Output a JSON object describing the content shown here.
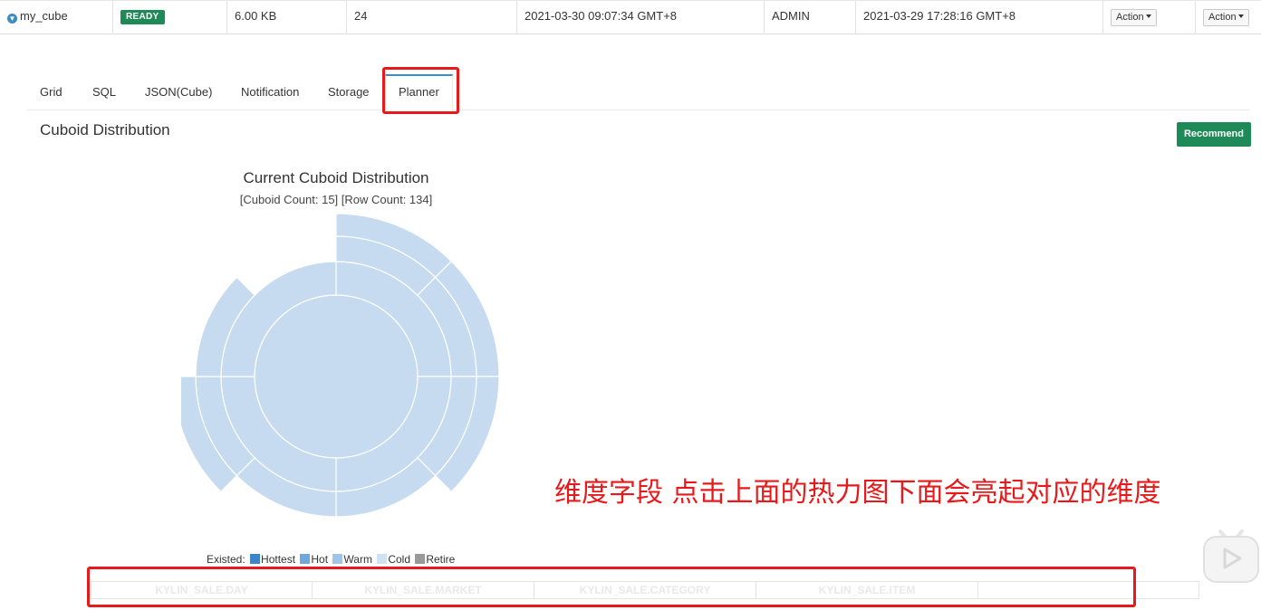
{
  "cube_row": {
    "name": "my_cube",
    "status": "READY",
    "size": "6.00 KB",
    "source_records": "24",
    "last_build_time": "2021-03-30 09:07:34 GMT+8",
    "owner": "ADMIN",
    "create_time": "2021-03-29 17:28:16 GMT+8",
    "action1": "Action",
    "action2": "Action"
  },
  "tabs": [
    {
      "label": "Grid"
    },
    {
      "label": "SQL"
    },
    {
      "label": "JSON(Cube)"
    },
    {
      "label": "Notification"
    },
    {
      "label": "Storage"
    },
    {
      "label": "Planner",
      "active": true
    }
  ],
  "planner": {
    "section_title": "Cuboid Distribution",
    "recommend_label": "Recommend",
    "chart_title": "Current Cuboid Distribution",
    "chart_subtitle": "[Cuboid Count: 15] [Row Count: 134]"
  },
  "legend": {
    "prefix": "Existed:",
    "items": [
      {
        "label": "Hottest",
        "color": "#3d85c6"
      },
      {
        "label": "Hot",
        "color": "#6fa8dc"
      },
      {
        "label": "Warm",
        "color": "#9fc5e8"
      },
      {
        "label": "Cold",
        "color": "#cfe2f3"
      },
      {
        "label": "Retire",
        "color": "#999999"
      }
    ]
  },
  "sunburst_color": "#c6dbef",
  "annotation_text": "维度字段 点击上面的热力图下面会亮起对应的维度",
  "dimensions": [
    "KYLIN_SALE.DAY",
    "KYLIN_SALE.MARKET",
    "KYLIN_SALE.CATEGORY",
    "KYLIN_SALE.ITEM",
    ""
  ]
}
